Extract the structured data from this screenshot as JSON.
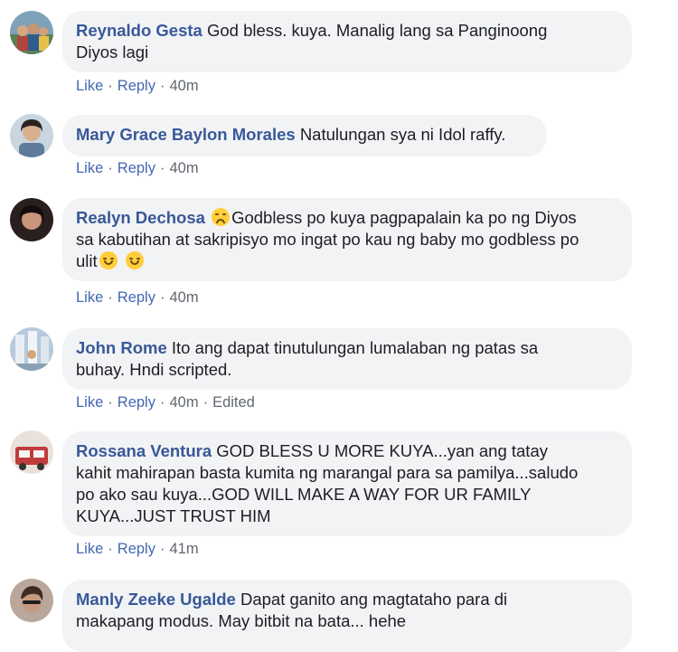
{
  "comments": [
    {
      "author": "Reynaldo Gesta",
      "line1": "God bless. kuya. Manalig lang sa Panginoong",
      "line2": "Diyos lagi",
      "like": "Like",
      "reply": "Reply",
      "time": "40m",
      "avatar_color": "#4b7a9a"
    },
    {
      "author": "Mary Grace Baylon Morales",
      "line1": "Natulungan sya ni Idol raffy.",
      "like": "Like",
      "reply": "Reply",
      "time": "40m",
      "avatar_color": "#6f8aa3"
    },
    {
      "author": "Realyn Dechosa",
      "line1": "Godbless po kuya pagpapalain ka po ng Diyos",
      "line2": "sa kabutihan at sakripisyo mo ingat po kau ng baby mo godbless po",
      "line3": "ulit",
      "emoji_sad": "disappointed-face-emoji",
      "emoji_smile": "smiling-face-emoji",
      "like": "Like",
      "reply": "Reply",
      "time": "40m",
      "avatar_color": "#3a2a2a"
    },
    {
      "author": "John Rome",
      "line1": "Ito ang dapat tinutulungan lumalaban ng patas sa",
      "line2": "buhay. Hndi scripted.",
      "like": "Like",
      "reply": "Reply",
      "time": "40m",
      "edited": "Edited",
      "avatar_color": "#9fb6cf"
    },
    {
      "author": "Rossana Ventura",
      "line1": "GOD BLESS U MORE KUYA...yan ang tatay",
      "line2": "kahit mahirapan basta kumita ng marangal para sa pamilya...saludo",
      "line3": "po ako sau kuya...GOD WILL MAKE A WAY FOR UR FAMILY",
      "line4": "KUYA...JUST TRUST HIM",
      "like": "Like",
      "reply": "Reply",
      "time": "41m",
      "avatar_color": "#c24a4a"
    },
    {
      "author": "Manly Zeeke Ugalde",
      "line1": "Dapat ganito ang magtataho para di",
      "line2": "makapang modus. May bitbit na bata... hehe",
      "avatar_color": "#8a6a55"
    }
  ],
  "separator": "·",
  "colors": {
    "author_link": "#385898",
    "action_link": "#4267b2",
    "bubble_bg": "#f2f3f5",
    "meta_text": "#606770"
  }
}
